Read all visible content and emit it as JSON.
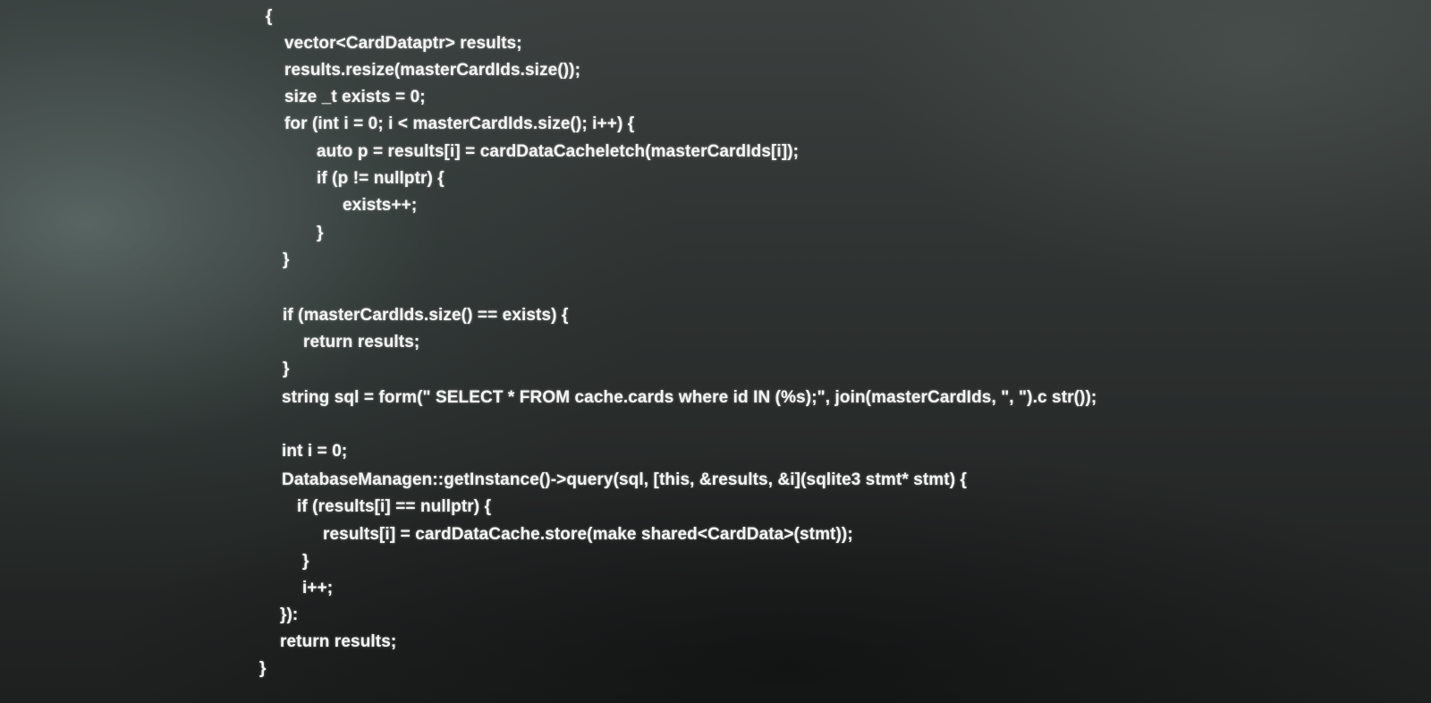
{
  "code_lines": [
    "{",
    "vector<CardDataptr> results;",
    "results.resize(masterCardIds.size());",
    "size _t exists = 0;",
    "for (int i = 0; i < masterCardIds.size(); i++) {",
    "auto p = results[i] = cardDataCacheletch(masterCardIds[i]);",
    "if (p != nullptr) {",
    "exists++;",
    "}",
    "}",
    "if (masterCardIds.size() == exists) {",
    "return results;",
    "}",
    "string sql = form(\" SELECT * FROM cache.cards where id IN (%s);\", join(masterCardIds, \", \").c str());",
    "int i = 0;",
    "DatabaseManagen::getInstance()->query(sql, [this, &results, &i](sqlite3 stmt* stmt) {",
    "if (results[i] == nullptr) {",
    "results[i] = cardDataCache.store(make shared<CardData>(stmt));",
    "}",
    "i++;",
    "}):",
    "return results;",
    "}"
  ]
}
